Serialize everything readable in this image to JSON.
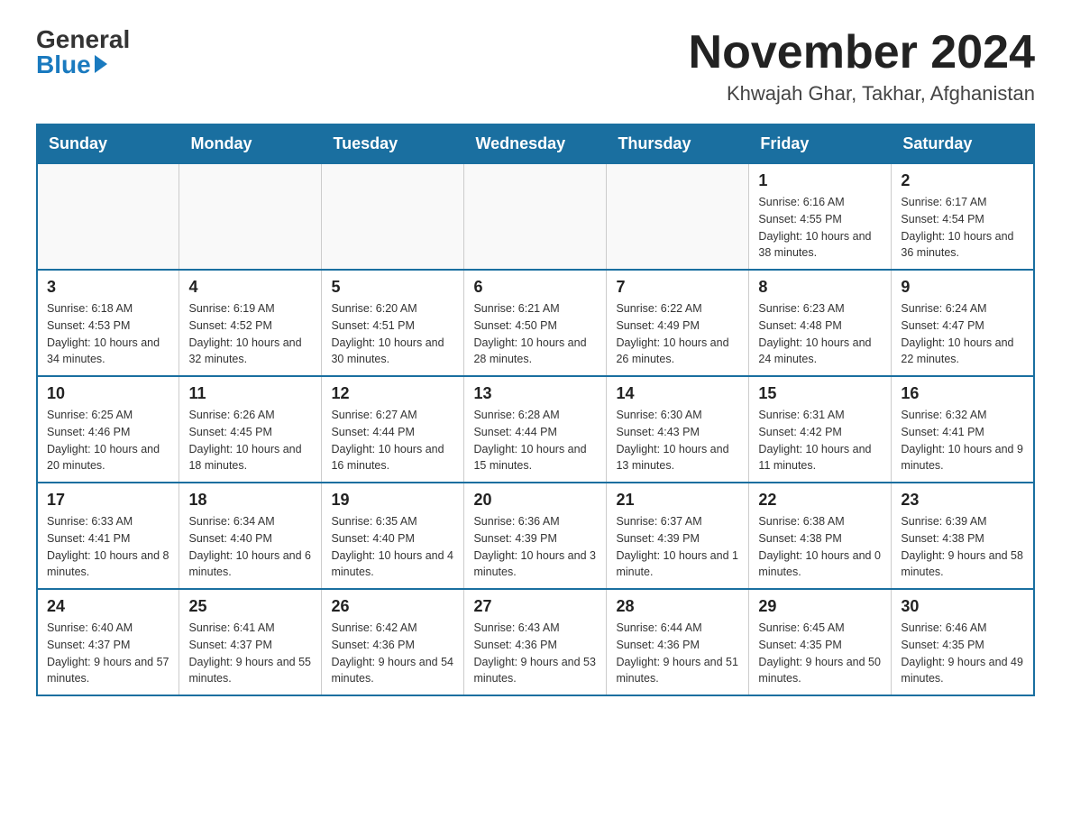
{
  "header": {
    "logo_general": "General",
    "logo_blue": "Blue",
    "month_title": "November 2024",
    "location": "Khwajah Ghar, Takhar, Afghanistan"
  },
  "days_of_week": [
    "Sunday",
    "Monday",
    "Tuesday",
    "Wednesday",
    "Thursday",
    "Friday",
    "Saturday"
  ],
  "weeks": [
    [
      {
        "day": "",
        "info": ""
      },
      {
        "day": "",
        "info": ""
      },
      {
        "day": "",
        "info": ""
      },
      {
        "day": "",
        "info": ""
      },
      {
        "day": "",
        "info": ""
      },
      {
        "day": "1",
        "info": "Sunrise: 6:16 AM\nSunset: 4:55 PM\nDaylight: 10 hours and 38 minutes."
      },
      {
        "day": "2",
        "info": "Sunrise: 6:17 AM\nSunset: 4:54 PM\nDaylight: 10 hours and 36 minutes."
      }
    ],
    [
      {
        "day": "3",
        "info": "Sunrise: 6:18 AM\nSunset: 4:53 PM\nDaylight: 10 hours and 34 minutes."
      },
      {
        "day": "4",
        "info": "Sunrise: 6:19 AM\nSunset: 4:52 PM\nDaylight: 10 hours and 32 minutes."
      },
      {
        "day": "5",
        "info": "Sunrise: 6:20 AM\nSunset: 4:51 PM\nDaylight: 10 hours and 30 minutes."
      },
      {
        "day": "6",
        "info": "Sunrise: 6:21 AM\nSunset: 4:50 PM\nDaylight: 10 hours and 28 minutes."
      },
      {
        "day": "7",
        "info": "Sunrise: 6:22 AM\nSunset: 4:49 PM\nDaylight: 10 hours and 26 minutes."
      },
      {
        "day": "8",
        "info": "Sunrise: 6:23 AM\nSunset: 4:48 PM\nDaylight: 10 hours and 24 minutes."
      },
      {
        "day": "9",
        "info": "Sunrise: 6:24 AM\nSunset: 4:47 PM\nDaylight: 10 hours and 22 minutes."
      }
    ],
    [
      {
        "day": "10",
        "info": "Sunrise: 6:25 AM\nSunset: 4:46 PM\nDaylight: 10 hours and 20 minutes."
      },
      {
        "day": "11",
        "info": "Sunrise: 6:26 AM\nSunset: 4:45 PM\nDaylight: 10 hours and 18 minutes."
      },
      {
        "day": "12",
        "info": "Sunrise: 6:27 AM\nSunset: 4:44 PM\nDaylight: 10 hours and 16 minutes."
      },
      {
        "day": "13",
        "info": "Sunrise: 6:28 AM\nSunset: 4:44 PM\nDaylight: 10 hours and 15 minutes."
      },
      {
        "day": "14",
        "info": "Sunrise: 6:30 AM\nSunset: 4:43 PM\nDaylight: 10 hours and 13 minutes."
      },
      {
        "day": "15",
        "info": "Sunrise: 6:31 AM\nSunset: 4:42 PM\nDaylight: 10 hours and 11 minutes."
      },
      {
        "day": "16",
        "info": "Sunrise: 6:32 AM\nSunset: 4:41 PM\nDaylight: 10 hours and 9 minutes."
      }
    ],
    [
      {
        "day": "17",
        "info": "Sunrise: 6:33 AM\nSunset: 4:41 PM\nDaylight: 10 hours and 8 minutes."
      },
      {
        "day": "18",
        "info": "Sunrise: 6:34 AM\nSunset: 4:40 PM\nDaylight: 10 hours and 6 minutes."
      },
      {
        "day": "19",
        "info": "Sunrise: 6:35 AM\nSunset: 4:40 PM\nDaylight: 10 hours and 4 minutes."
      },
      {
        "day": "20",
        "info": "Sunrise: 6:36 AM\nSunset: 4:39 PM\nDaylight: 10 hours and 3 minutes."
      },
      {
        "day": "21",
        "info": "Sunrise: 6:37 AM\nSunset: 4:39 PM\nDaylight: 10 hours and 1 minute."
      },
      {
        "day": "22",
        "info": "Sunrise: 6:38 AM\nSunset: 4:38 PM\nDaylight: 10 hours and 0 minutes."
      },
      {
        "day": "23",
        "info": "Sunrise: 6:39 AM\nSunset: 4:38 PM\nDaylight: 9 hours and 58 minutes."
      }
    ],
    [
      {
        "day": "24",
        "info": "Sunrise: 6:40 AM\nSunset: 4:37 PM\nDaylight: 9 hours and 57 minutes."
      },
      {
        "day": "25",
        "info": "Sunrise: 6:41 AM\nSunset: 4:37 PM\nDaylight: 9 hours and 55 minutes."
      },
      {
        "day": "26",
        "info": "Sunrise: 6:42 AM\nSunset: 4:36 PM\nDaylight: 9 hours and 54 minutes."
      },
      {
        "day": "27",
        "info": "Sunrise: 6:43 AM\nSunset: 4:36 PM\nDaylight: 9 hours and 53 minutes."
      },
      {
        "day": "28",
        "info": "Sunrise: 6:44 AM\nSunset: 4:36 PM\nDaylight: 9 hours and 51 minutes."
      },
      {
        "day": "29",
        "info": "Sunrise: 6:45 AM\nSunset: 4:35 PM\nDaylight: 9 hours and 50 minutes."
      },
      {
        "day": "30",
        "info": "Sunrise: 6:46 AM\nSunset: 4:35 PM\nDaylight: 9 hours and 49 minutes."
      }
    ]
  ]
}
